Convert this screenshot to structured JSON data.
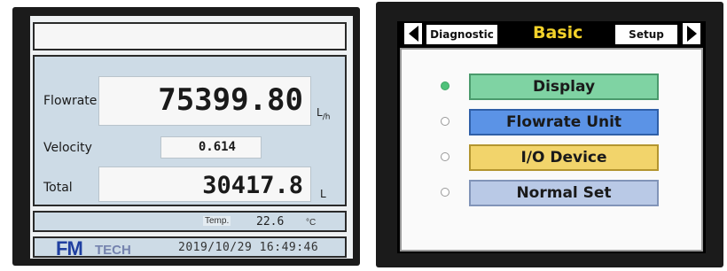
{
  "meter": {
    "flowrate_label": "Flowrate",
    "flowrate_value": "75399.80",
    "flowrate_unit_main": "L",
    "flowrate_unit_sub": "/h",
    "velocity_label": "Velocity",
    "velocity_value": "0.614",
    "total_label": "Total",
    "total_value": "30417.8",
    "total_unit": "L",
    "temp_label": "Temp.",
    "temp_value": "22.6",
    "temp_unit": "°C",
    "brand_fm": "FM",
    "brand_tech": "TECH",
    "datetime": "2019/10/29  16:49:46"
  },
  "menu": {
    "tabs": {
      "left": "Diagnostic",
      "active": "Basic",
      "right": "Setup"
    },
    "items": [
      {
        "label": "Display",
        "selected": true,
        "color": "#7fd3a3",
        "border": "#4a9a6c"
      },
      {
        "label": "Flowrate Unit",
        "selected": false,
        "color": "#5b93e6",
        "border": "#2f5fa8"
      },
      {
        "label": "I/O Device",
        "selected": false,
        "color": "#f2d46b",
        "border": "#b3952f"
      },
      {
        "label": "Normal Set",
        "selected": false,
        "color": "#b9c9e6",
        "border": "#8194b8"
      }
    ]
  }
}
